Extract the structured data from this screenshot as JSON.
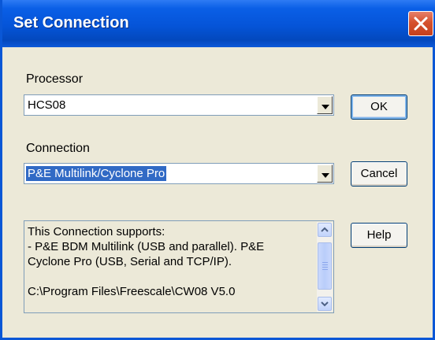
{
  "window": {
    "title": "Set Connection"
  },
  "processor": {
    "label": "Processor",
    "value": "HCS08"
  },
  "connection": {
    "label": "Connection",
    "value": "P&E Multilink/Cyclone Pro"
  },
  "buttons": {
    "ok": "OK",
    "cancel": "Cancel",
    "help": "Help"
  },
  "description": {
    "line1": "This Connection supports:",
    "line2": "- P&E BDM Multilink (USB and parallel). P&E",
    "line3": "Cyclone Pro (USB, Serial and TCP/IP).",
    "line4": "C:\\Program Files\\Freescale\\CW08 V5.0"
  },
  "colors": {
    "titlebar": "#0554d8",
    "selection": "#316ac5",
    "close": "#d5512d"
  },
  "icons": [
    "close-icon",
    "chevron-down-icon",
    "scroll-up-icon",
    "scroll-down-icon"
  ]
}
